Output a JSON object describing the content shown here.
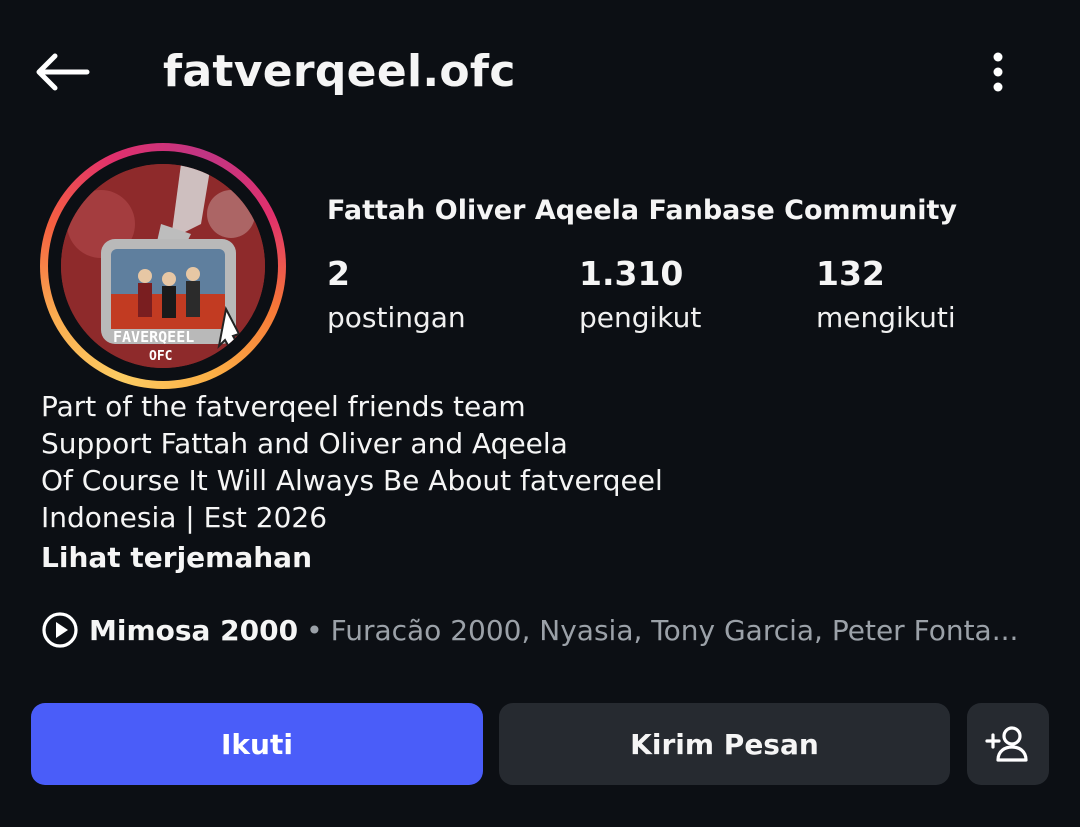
{
  "header": {
    "back_icon": "arrow-left-icon",
    "username": "fatverqeel.ofc",
    "more_icon": "more-vertical-icon"
  },
  "profile": {
    "avatar_text_line1": "FAVERQEEL",
    "avatar_text_line2": "OFC",
    "full_name": "Fattah Oliver Aqeela Fanbase Community",
    "stats": [
      {
        "value": "2",
        "label": "postingan"
      },
      {
        "value": "1.310",
        "label": "pengikut"
      },
      {
        "value": "132",
        "label": "mengikuti"
      }
    ]
  },
  "bio": {
    "lines": [
      "Part of the fatverqeel friends team",
      "Support Fattah and Oliver and Aqeela",
      "Of Course It Will Always Be About fatverqeel",
      "Indonesia | Est 2026"
    ],
    "translate_label": "Lihat terjemahan"
  },
  "music": {
    "icon": "play-circle-icon",
    "song": "Mimosa 2000",
    "separator": "•",
    "artists": "Furacão 2000, Nyasia, Tony Garcia, Peter Fonta..."
  },
  "actions": {
    "follow_label": "Ikuti",
    "message_label": "Kirim Pesan",
    "suggest_icon": "add-person-icon"
  },
  "colors": {
    "background": "#0c0f14",
    "follow_button": "#4a5df9",
    "secondary_button": "#262a30",
    "muted_text": "#9ba1a8"
  }
}
